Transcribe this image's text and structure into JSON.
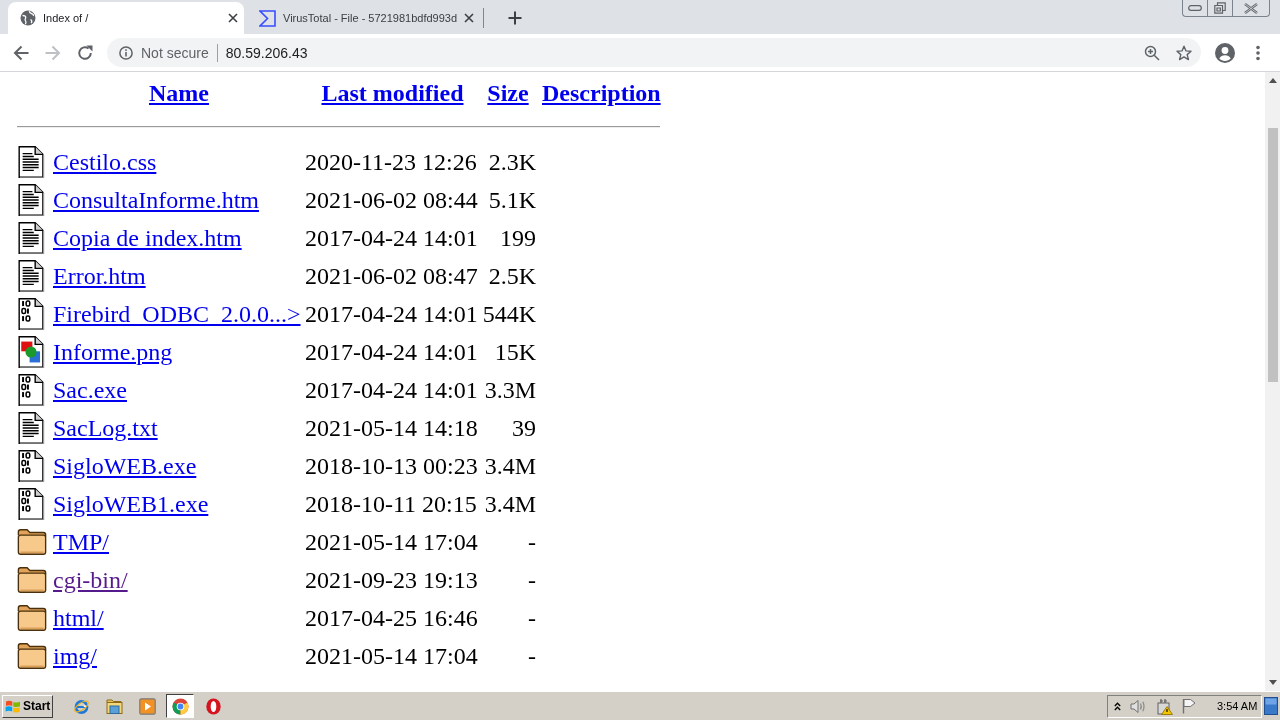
{
  "browser": {
    "tabs": [
      {
        "kind": "globe",
        "title": "Index of /",
        "selected": true
      },
      {
        "kind": "sigma",
        "title": "VirusTotal - File - 5721981bdfd993d",
        "selected": false
      }
    ],
    "navigation": [
      {
        "kind": "back",
        "disabled": false
      },
      {
        "kind": "forward",
        "disabled": true
      },
      {
        "kind": "reload",
        "disabled": false
      }
    ],
    "address_bar": {
      "security": "Not secure",
      "url": "80.59.206.43"
    }
  },
  "listing": {
    "columns": [
      "Name",
      "Last modified",
      "Size",
      "Description"
    ],
    "rows": [
      {
        "kind": "text",
        "name": "Cestilo.css",
        "modified": "2020-11-23 12:26",
        "size": "2.3K",
        "visited": false
      },
      {
        "kind": "text",
        "name": "ConsultaInforme.htm",
        "modified": "2021-06-02 08:44",
        "size": "5.1K",
        "visited": false
      },
      {
        "kind": "text",
        "name": "Copia de index.htm",
        "modified": "2017-04-24 14:01",
        "size": "199",
        "visited": false
      },
      {
        "kind": "text",
        "name": "Error.htm",
        "modified": "2021-06-02 08:47",
        "size": "2.5K",
        "visited": false
      },
      {
        "kind": "binary",
        "name": "Firebird_ODBC_2.0.0...>",
        "modified": "2017-04-24 14:01",
        "size": "544K",
        "visited": false
      },
      {
        "kind": "image",
        "name": "Informe.png",
        "modified": "2017-04-24 14:01",
        "size": "15K",
        "visited": false
      },
      {
        "kind": "binary",
        "name": "Sac.exe",
        "modified": "2017-04-24 14:01",
        "size": "3.3M",
        "visited": false
      },
      {
        "kind": "text",
        "name": "SacLog.txt",
        "modified": "2021-05-14 14:18",
        "size": "39",
        "visited": false
      },
      {
        "kind": "binary",
        "name": "SigloWEB.exe",
        "modified": "2018-10-13 00:23",
        "size": "3.4M",
        "visited": false
      },
      {
        "kind": "binary",
        "name": "SigloWEB1.exe",
        "modified": "2018-10-11 20:15",
        "size": "3.4M",
        "visited": false
      },
      {
        "kind": "folder",
        "name": "TMP/",
        "modified": "2021-05-14 17:04",
        "size": "-",
        "visited": false
      },
      {
        "kind": "folder",
        "name": "cgi-bin/",
        "modified": "2021-09-23 19:13",
        "size": "-",
        "visited": true
      },
      {
        "kind": "folder",
        "name": "html/",
        "modified": "2017-04-25 16:46",
        "size": "-",
        "visited": false
      },
      {
        "kind": "folder",
        "name": "img/",
        "modified": "2021-05-14 17:04",
        "size": "-",
        "visited": false
      }
    ]
  },
  "taskbar": {
    "start": "Start",
    "apps": [
      {
        "kind": "ie",
        "selected": false
      },
      {
        "kind": "explorer",
        "selected": false
      },
      {
        "kind": "media",
        "selected": false
      },
      {
        "kind": "chrome",
        "selected": true
      },
      {
        "kind": "opera",
        "selected": false
      }
    ],
    "clock": "3:54 AM"
  }
}
